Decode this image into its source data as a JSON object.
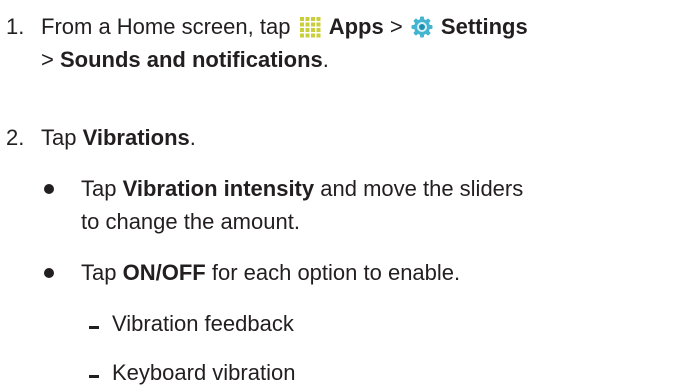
{
  "steps": [
    {
      "number": "1.",
      "text_pre": "From a Home screen, tap",
      "apps_icon": "apps-grid-icon",
      "apps_label": "Apps",
      "separator1": ">",
      "settings_icon": "settings-gear-icon",
      "settings_label": "Settings",
      "separator2": ">",
      "sounds_label": "Sounds and notifications",
      "end_punct": "."
    },
    {
      "number": "2.",
      "text_pre": "Tap",
      "vibrations_label": "Vibrations",
      "end_punct": "."
    }
  ],
  "bullets": [
    {
      "text_pre": "Tap",
      "bold": "Vibration intensity",
      "text_post": "and move the sliders",
      "text_line2": "to change the amount."
    },
    {
      "text_pre": "Tap",
      "bold": "ON/OFF",
      "text_post": "for each option to enable."
    }
  ],
  "sub_items": [
    "Vibration feedback",
    "Keyboard vibration"
  ],
  "colors": {
    "text": "#231f20",
    "apps_icon": "#c8cf3a",
    "settings_icon_outer": "#43b5d1",
    "settings_icon_inner": "#1f8fb3"
  }
}
